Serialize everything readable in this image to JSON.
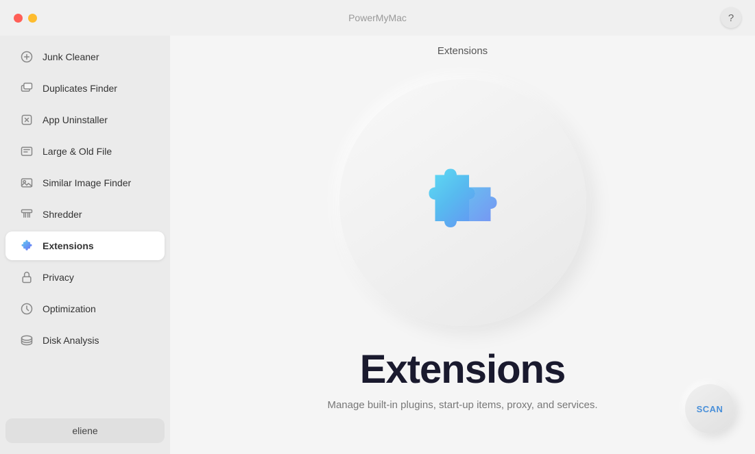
{
  "app": {
    "title": "PowerMyMac",
    "header_label": "Extensions"
  },
  "help_button": "?",
  "sidebar": {
    "items": [
      {
        "id": "junk-cleaner",
        "label": "Junk Cleaner",
        "active": false
      },
      {
        "id": "duplicates-finder",
        "label": "Duplicates Finder",
        "active": false
      },
      {
        "id": "app-uninstaller",
        "label": "App Uninstaller",
        "active": false
      },
      {
        "id": "large-old-file",
        "label": "Large & Old File",
        "active": false
      },
      {
        "id": "similar-image-finder",
        "label": "Similar Image Finder",
        "active": false
      },
      {
        "id": "shredder",
        "label": "Shredder",
        "active": false
      },
      {
        "id": "extensions",
        "label": "Extensions",
        "active": true
      },
      {
        "id": "privacy",
        "label": "Privacy",
        "active": false
      },
      {
        "id": "optimization",
        "label": "Optimization",
        "active": false
      },
      {
        "id": "disk-analysis",
        "label": "Disk Analysis",
        "active": false
      }
    ],
    "user": "eliene"
  },
  "content": {
    "title": "Extensions",
    "subtitle": "Manage built-in plugins, start-up items, proxy, and services."
  },
  "scan_button": "SCAN"
}
